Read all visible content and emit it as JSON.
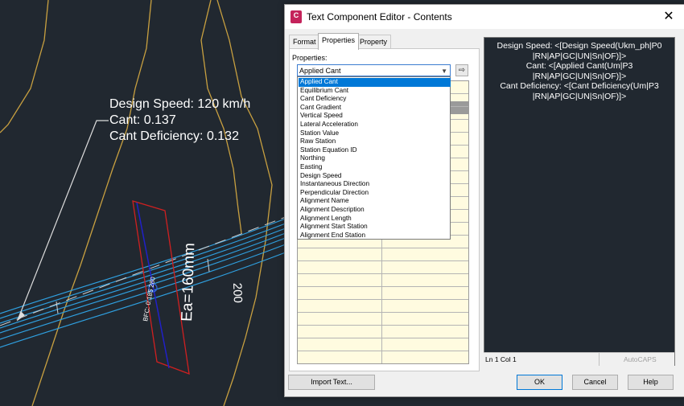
{
  "drawing": {
    "annotation": {
      "design_speed": "Design Speed: 120 km/h",
      "cant": "Cant: 0.137",
      "cant_deficiency": "Cant Deficiency: 0.132"
    },
    "station_label": "200",
    "ea_label": "Ea=160mm",
    "bfc_label": "BFC: 0.185 280",
    "colors": {
      "background": "#212830",
      "alignment": "#2fa0e0",
      "contour": "#c8a040",
      "cant_marker_red": "#d02020",
      "cant_marker_blue": "#2020c8"
    }
  },
  "dialog": {
    "title": "Text Component Editor - Contents",
    "app_icon": "civil3d-app-icon",
    "close_glyph": "✕",
    "tabs": [
      "Format",
      "Properties",
      "Property Sets"
    ],
    "active_tab": "Properties",
    "properties_label": "Properties:",
    "selected_property": "Applied Cant",
    "add_arrow_glyph": "⇨",
    "dropdown_options": [
      "Applied Cant",
      "Equilibrium Cant",
      "Cant Deficiency",
      "Cant Gradient",
      "Vertical Speed",
      "Lateral Acceleration",
      "Station Value",
      "Raw Station",
      "Station Equation ID",
      "Northing",
      "Easting",
      "Design Speed",
      "Instantaneous Direction",
      "Perpendicular Direction",
      "Alignment Name",
      "Alignment Description",
      "Alignment Length",
      "Alignment Start Station",
      "Alignment End Station"
    ],
    "preview_lines": [
      "Design Speed: <[Design Speed(Ukm_ph|P0",
      "|RN|AP|GC|UN|Sn|OF)]>",
      "Cant: <[Applied Cant(Um|P3",
      "|RN|AP|GC|UN|Sn|OF)]>",
      "Cant Deficiency: <[Cant Deficiency(Um|P3",
      "|RN|AP|GC|UN|Sn|OF)]>"
    ],
    "status_position": "Ln 1 Col 1",
    "status_app": "AutoCAPS",
    "buttons": {
      "import": "Import Text...",
      "ok": "OK",
      "cancel": "Cancel",
      "help": "Help"
    },
    "colors": {
      "selection": "#0078d7",
      "grid_bg": "#fffbe0"
    }
  }
}
